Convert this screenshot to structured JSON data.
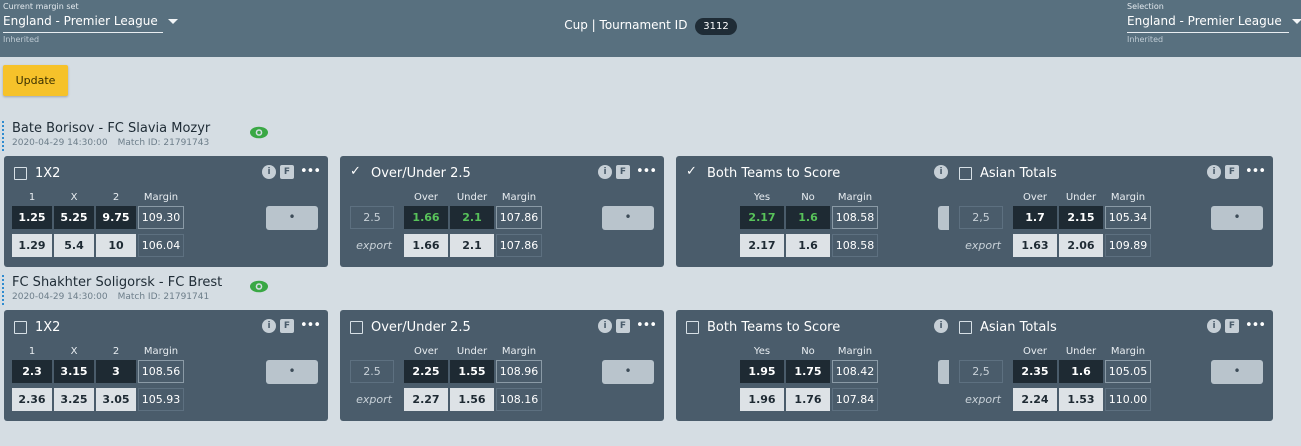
{
  "header": {
    "left": {
      "caption": "Current margin set",
      "value": "England - Premier League",
      "sub": "Inherited"
    },
    "center": {
      "label": "Cup | Tournament ID",
      "tournament_id": "3112"
    },
    "right": {
      "caption": "Selection",
      "value": "England - Premier League",
      "sub": "Inherited"
    }
  },
  "update_label": "Update",
  "colors": {
    "accent": "#f6c22a",
    "card_bg": "#4a5c6b",
    "header_bg": "#58707f",
    "green": "#58c35a"
  },
  "matches": [
    {
      "name": "Bate Borisov - FC Slavia Mozyr",
      "datetime": "2020-04-29 14:30:00",
      "match_id": "Match ID: 21791743",
      "markets": {
        "x12": {
          "title": "1X2",
          "checked": false,
          "cols": [
            "1",
            "X",
            "2",
            "Margin"
          ],
          "row1": [
            "1.25",
            "5.25",
            "9.75",
            "109.30"
          ],
          "row2": [
            "1.29",
            "5.4",
            "10",
            "106.04"
          ]
        },
        "ou": {
          "title": "Over/Under 2.5",
          "checked": true,
          "cols": [
            "Over",
            "Under",
            "Margin"
          ],
          "line": "2.5",
          "export": "export",
          "row1": [
            "1.66",
            "2.1",
            "107.86"
          ],
          "row2": [
            "1.66",
            "2.1",
            "107.86"
          ]
        },
        "btts": {
          "title": "Both Teams to Score",
          "checked": true,
          "cols": [
            "Yes",
            "No",
            "Margin"
          ],
          "row1": [
            "2.17",
            "1.6",
            "108.58"
          ],
          "row2": [
            "2.17",
            "1.6",
            "108.58"
          ]
        },
        "asian": {
          "title": "Asian Totals",
          "checked": false,
          "cols": [
            "Over",
            "Under",
            "Margin"
          ],
          "line": "2,5",
          "export": "export",
          "row1": [
            "1.7",
            "2.15",
            "105.34"
          ],
          "row2": [
            "1.63",
            "2.06",
            "109.89"
          ]
        }
      }
    },
    {
      "name": "FC Shakhter Soligorsk - FC Brest",
      "datetime": "2020-04-29 14:30:00",
      "match_id": "Match ID: 21791741",
      "markets": {
        "x12": {
          "title": "1X2",
          "checked": false,
          "cols": [
            "1",
            "X",
            "2",
            "Margin"
          ],
          "row1": [
            "2.3",
            "3.15",
            "3",
            "108.56"
          ],
          "row2": [
            "2.36",
            "3.25",
            "3.05",
            "105.93"
          ]
        },
        "ou": {
          "title": "Over/Under 2.5",
          "checked": false,
          "cols": [
            "Over",
            "Under",
            "Margin"
          ],
          "line": "2.5",
          "export": "export",
          "row1": [
            "2.25",
            "1.55",
            "108.96"
          ],
          "row2": [
            "2.27",
            "1.56",
            "108.16"
          ]
        },
        "btts": {
          "title": "Both Teams to Score",
          "checked": false,
          "cols": [
            "Yes",
            "No",
            "Margin"
          ],
          "row1": [
            "1.95",
            "1.75",
            "108.42"
          ],
          "row2": [
            "1.96",
            "1.76",
            "107.84"
          ]
        },
        "asian": {
          "title": "Asian Totals",
          "checked": false,
          "cols": [
            "Over",
            "Under",
            "Margin"
          ],
          "line": "2,5",
          "export": "export",
          "row1": [
            "2.35",
            "1.6",
            "105.05"
          ],
          "row2": [
            "2.24",
            "1.53",
            "110.00"
          ]
        }
      }
    }
  ],
  "dot_label": "•",
  "icons": {
    "info": "i",
    "favorite": "F",
    "more": "•••"
  }
}
